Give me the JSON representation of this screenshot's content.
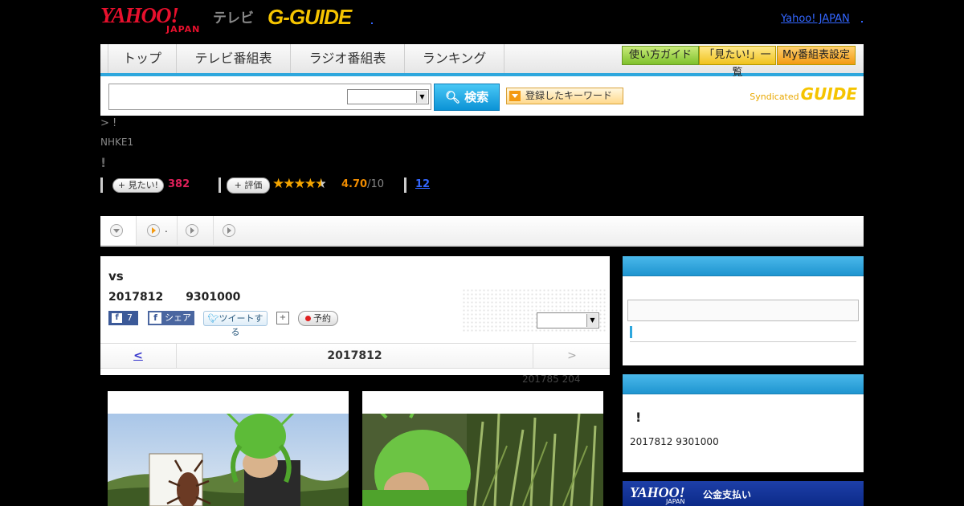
{
  "header": {
    "yahoo_logo": "YAHOO!",
    "yahoo_logo_sub": "JAPAN",
    "tv_label": "テレビ",
    "gguide_logo": "G-GUIDE",
    "yahoo_japan_link": "Yahoo! JAPAN"
  },
  "nav": {
    "tabs": [
      {
        "label": "トップ"
      },
      {
        "label": "テレビ番組表"
      },
      {
        "label": "ラジオ番組表"
      },
      {
        "label": "ランキング"
      }
    ],
    "buttons": [
      {
        "label": "使い方ガイド",
        "color": "#7fc12c"
      },
      {
        "label": "「見たい!」一覧",
        "color": "#f0c21e"
      },
      {
        "label": "My番組表設定",
        "color": "#f39a12"
      }
    ]
  },
  "search": {
    "value": "",
    "select_value": "",
    "button_label": "検索",
    "keyword_button": "登録したキーワード",
    "syndicated_label": "Syndicated",
    "syndicated_logo": "GUIDE"
  },
  "program": {
    "breadcrumb": "> !",
    "channel": "NHKE1",
    "title": "!",
    "want_label": "見たい!",
    "want_count": "382",
    "rate_label": "評価",
    "stars": 4.7,
    "score": "4.70",
    "score_max": "/10",
    "review_count": "12"
  },
  "tabstrip": {
    "items": [
      {
        "icon": "circle-down-icon",
        "label": ""
      },
      {
        "icon": "circle-play-orange-icon",
        "label": "."
      },
      {
        "icon": "circle-play-icon",
        "label": ""
      },
      {
        "icon": "circle-play-icon",
        "label": ""
      }
    ]
  },
  "episode": {
    "title": "vs",
    "datetime": "2017812　　9301000",
    "fb_like_count": "7",
    "share_label": "シェア",
    "tweet_label": "ツイートする",
    "reserve_label": "予約",
    "select_value": "",
    "prev_label": "<",
    "date_label": "2017812",
    "next_label": ">",
    "meta": "201785  204"
  },
  "sidebar": {
    "box2_bang": "!",
    "box2_datetime": "2017812  9301000",
    "yjpay_logo": "YAHOO!",
    "yjpay_sub": "JAPAN",
    "yjpay_text": "公金支払い"
  },
  "colors": {
    "accent_blue": "#2ea7dd",
    "want_pink": "#e0205a",
    "star_orange": "#f5a600",
    "yahoo_red": "#e8102d",
    "gguide_yellow": "#f5c400"
  }
}
